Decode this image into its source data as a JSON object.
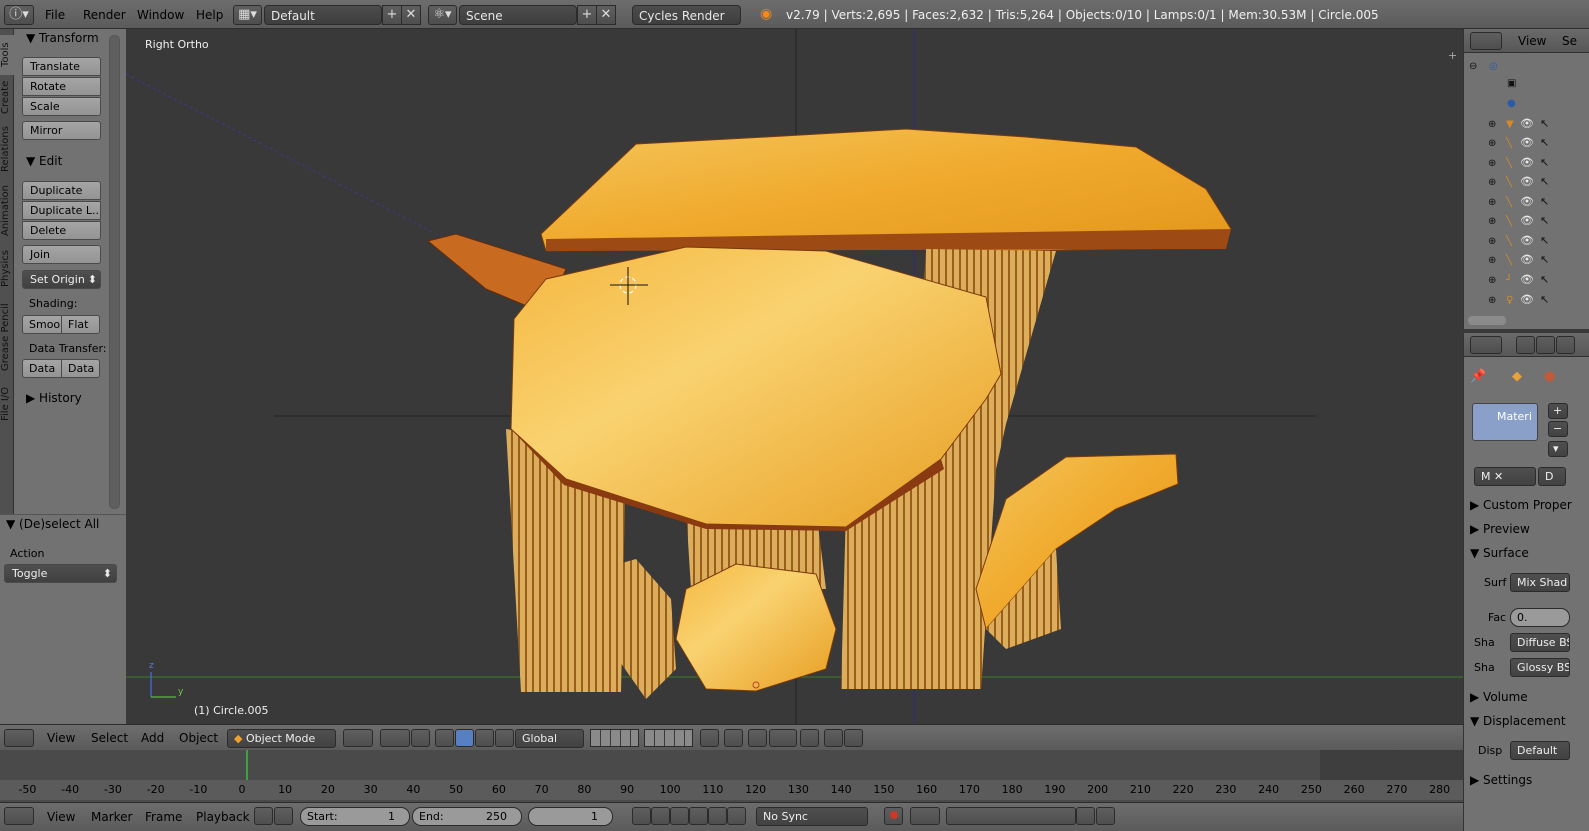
{
  "topbar": {
    "menus": [
      "File",
      "Render",
      "Window",
      "Help"
    ],
    "screen_layout": "Default",
    "scene": "Scene",
    "render_engine": "Cycles Render",
    "stats": "v2.79 | Verts:2,695 | Faces:2,632 | Tris:5,264 | Objects:0/10 | Lamps:0/1 | Mem:30.53M | Circle.005"
  },
  "tool_tabs": [
    "Tools",
    "Create",
    "Relations",
    "Animation",
    "Physics",
    "Grease Pencil",
    "File I/O"
  ],
  "tool_shelf": {
    "transform_header": "Transform",
    "transform_buttons": [
      "Translate",
      "Rotate",
      "Scale"
    ],
    "mirror": "Mirror",
    "edit_header": "Edit",
    "edit_buttons": [
      "Duplicate",
      "Duplicate L...",
      "Delete"
    ],
    "join": "Join",
    "set_origin": "Set Origin",
    "shading_label": "Shading:",
    "shading_smooth": "Smoo",
    "shading_flat": "Flat",
    "data_transfer_label": "Data Transfer:",
    "data_btn1": "Data",
    "data_btn2": "Data",
    "history_header": "History"
  },
  "operator_panel": {
    "title": "(De)select All",
    "action_label": "Action",
    "action_value": "Toggle"
  },
  "viewport": {
    "view_name": "Right Ortho",
    "object_info": "(1) Circle.005",
    "axis_z": "z",
    "axis_y": "y"
  },
  "outliner": {
    "view_menu": "View",
    "search_menu": "Se"
  },
  "properties": {
    "material_slot": "Materi",
    "material_name": "M",
    "data_btn": "D",
    "sections": {
      "custom_props": "Custom Proper",
      "preview": "Preview",
      "surface": "Surface",
      "volume": "Volume",
      "displacement": "Displacement",
      "settings": "Settings"
    },
    "surface_label": "Surf",
    "surface_value": "Mix Shad",
    "fac_label": "Fac",
    "fac_value": "0.",
    "shader1_label": "Sha",
    "shader1_value": "Diffuse BS",
    "shader2_label": "Sha",
    "shader2_value": "Glossy BS",
    "disp_label": "Disp",
    "disp_value": "Default"
  },
  "view3d_header": {
    "view": "View",
    "select": "Select",
    "add": "Add",
    "object": "Object",
    "mode": "Object Mode",
    "orientation": "Global"
  },
  "timeline": {
    "ticks": [
      "-50",
      "-40",
      "-30",
      "-20",
      "-10",
      "0",
      "10",
      "20",
      "30",
      "40",
      "50",
      "60",
      "70",
      "80",
      "90",
      "100",
      "110",
      "120",
      "130",
      "140",
      "150",
      "160",
      "170",
      "180",
      "190",
      "200",
      "210",
      "220",
      "230",
      "240",
      "250",
      "260",
      "270",
      "280"
    ],
    "menus": [
      "View",
      "Marker",
      "Frame",
      "Playback"
    ],
    "start_label": "Start:",
    "start_value": "1",
    "end_label": "End:",
    "end_value": "250",
    "current_frame": "1",
    "sync": "No Sync"
  }
}
